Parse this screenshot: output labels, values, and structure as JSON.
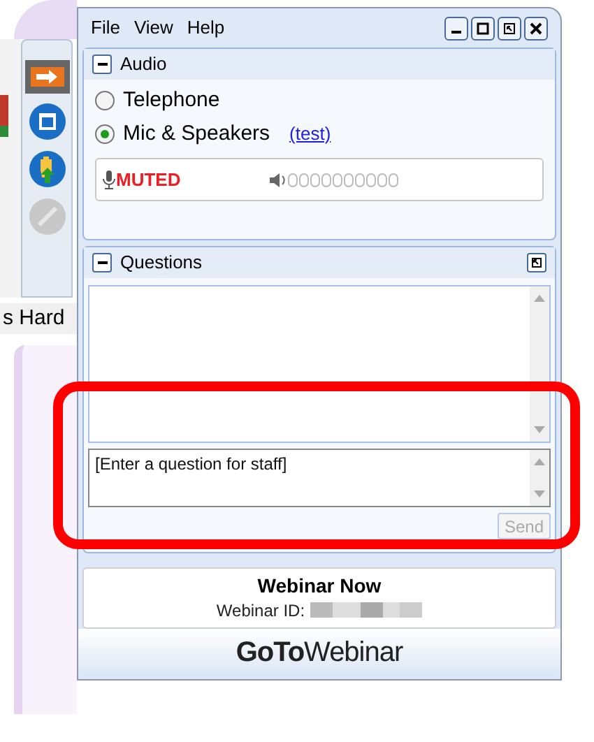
{
  "menu": [
    "File",
    "View",
    "Help"
  ],
  "audio": {
    "title": "Audio",
    "expanded": true,
    "options": [
      {
        "label": "Telephone",
        "selected": false
      },
      {
        "label": "Mic & Speakers",
        "selected": true
      }
    ],
    "test_link": "(test)",
    "mic_status": "MUTED"
  },
  "questions": {
    "title": "Questions",
    "expanded": true,
    "placeholder": "[Enter a question for staff]",
    "send": {
      "label": "Send",
      "disabled": true
    }
  },
  "side_tab": "s Hard",
  "webinar": {
    "title": "Webinar Now",
    "id_label": "Webinar ID:"
  },
  "logo": "**GoTo**Webinar"
}
